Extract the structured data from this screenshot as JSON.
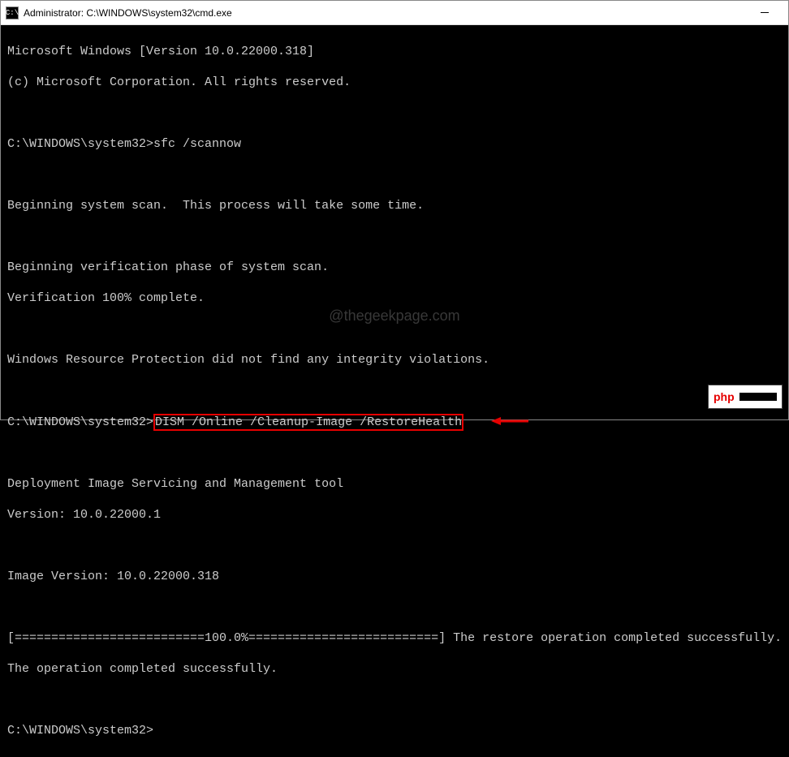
{
  "titlebar": {
    "icon_label": "C:\\",
    "title": "Administrator: C:\\WINDOWS\\system32\\cmd.exe"
  },
  "terminal": {
    "line1": "Microsoft Windows [Version 10.0.22000.318]",
    "line2": "(c) Microsoft Corporation. All rights reserved.",
    "prompt1_path": "C:\\WINDOWS\\system32>",
    "prompt1_cmd": "sfc /scannow",
    "scan1": "Beginning system scan.  This process will take some time.",
    "scan2": "Beginning verification phase of system scan.",
    "scan3": "Verification 100% complete.",
    "scan4": "Windows Resource Protection did not find any integrity violations.",
    "prompt2_path": "C:\\WINDOWS\\system32>",
    "prompt2_cmd": "DISM /Online /Cleanup-Image /RestoreHealth",
    "dism1": "Deployment Image Servicing and Management tool",
    "dism2": "Version: 10.0.22000.1",
    "dism3": "Image Version: 10.0.22000.318",
    "progress": "[==========================100.0%==========================] The restore operation completed successfully.",
    "done": "The operation completed successfully.",
    "prompt3_path": "C:\\WINDOWS\\system32>"
  },
  "watermark": "@thegeekpage.com",
  "badge": {
    "text": "php"
  }
}
